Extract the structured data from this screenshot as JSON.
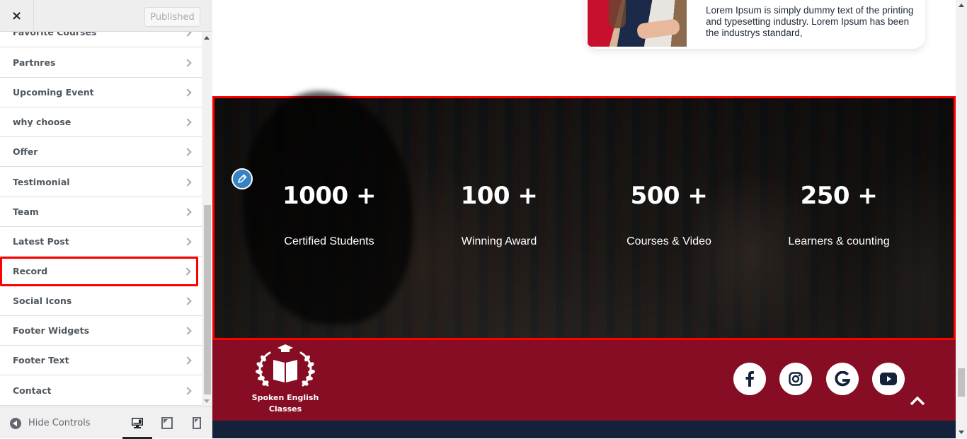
{
  "customizer": {
    "close_label": "×",
    "publish_label": "Published",
    "sections": [
      {
        "label": "Favorite Courses"
      },
      {
        "label": "Partnres"
      },
      {
        "label": "Upcoming Event"
      },
      {
        "label": "why choose"
      },
      {
        "label": "Offer"
      },
      {
        "label": "Testimonial"
      },
      {
        "label": "Team"
      },
      {
        "label": "Latest Post"
      },
      {
        "label": "Record",
        "highlighted": true
      },
      {
        "label": "Social Icons"
      },
      {
        "label": "Footer Widgets"
      },
      {
        "label": "Footer Text"
      },
      {
        "label": "Contact"
      }
    ],
    "footer": {
      "hide_controls_label": "Hide Controls",
      "devices": [
        "desktop",
        "tablet",
        "mobile"
      ],
      "active_device": "desktop"
    }
  },
  "preview": {
    "testimonial_card": {
      "text": "Lorem Ipsum is simply dummy text of the printing and typesetting industry. Lorem Ipsum has been the industrys standard,"
    },
    "record": {
      "stats": [
        {
          "number": "1000 +",
          "label": "Certified Students"
        },
        {
          "number": "100 +",
          "label": "Winning Award"
        },
        {
          "number": "500 +",
          "label": "Courses & Video"
        },
        {
          "number": "250 +",
          "label": "Learners & counting"
        }
      ]
    },
    "footer": {
      "logo_line1": "Spoken English",
      "logo_line2": "Classes",
      "social_icons": [
        "facebook-icon",
        "instagram-icon",
        "google-icon",
        "youtube-icon"
      ]
    },
    "colors": {
      "footer_red": "#870d24",
      "footer_navy": "#13223a",
      "highlight": "#ff0000",
      "edit_blue": "#3582c4"
    }
  }
}
